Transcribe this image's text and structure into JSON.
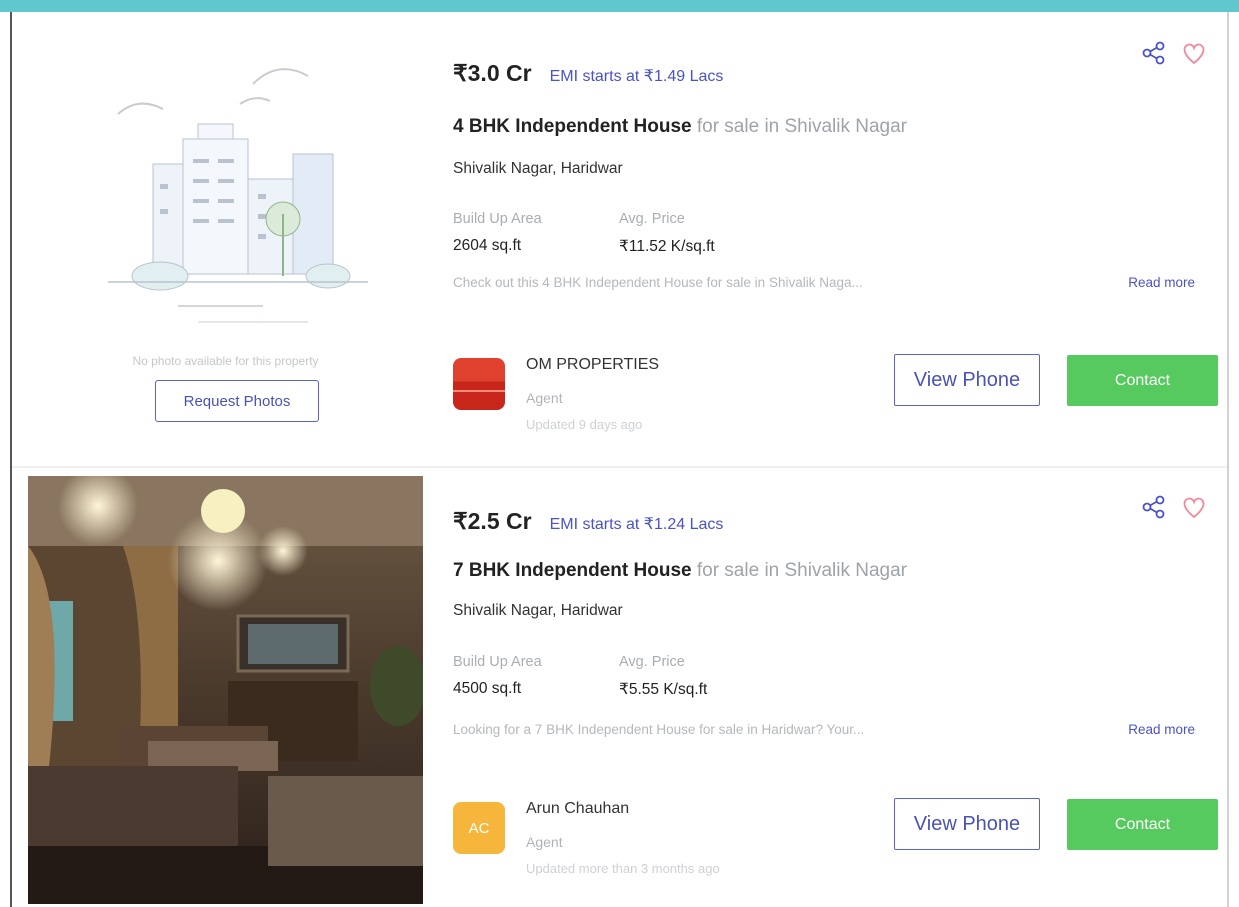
{
  "listings": [
    {
      "price": "₹3.0 Cr",
      "emi": "EMI starts at ₹1.49 Lacs",
      "title_bold": "4 BHK Independent House",
      "title_rest": " for sale in Shivalik Nagar",
      "locality": "Shivalik Nagar, Haridwar",
      "area_label": "Build Up Area",
      "area_value": "2604 sq.ft",
      "avg_label": "Avg. Price",
      "avg_value": "₹11.52 K/sq.ft",
      "description": "Check out this 4 BHK Independent House for sale in Shivalik Naga...",
      "read_more": "Read more",
      "no_photo_text": "No photo available for this property",
      "request_photos": "Request Photos",
      "agent_name": "OM PROPERTIES",
      "agent_role": "Agent",
      "updated": "Updated 9 days ago",
      "view_phone": "View Phone",
      "contact": "Contact"
    },
    {
      "price": "₹2.5 Cr",
      "emi": "EMI starts at ₹1.24 Lacs",
      "title_bold": "7 BHK Independent House",
      "title_rest": " for sale in Shivalik Nagar",
      "locality": "Shivalik Nagar, Haridwar",
      "area_label": "Build Up Area",
      "area_value": "4500 sq.ft",
      "avg_label": "Avg. Price",
      "avg_value": "₹5.55 K/sq.ft",
      "description": "Looking for a 7 BHK Independent House for sale in Haridwar? Your...",
      "read_more": "Read more",
      "agent_initials": "AC",
      "agent_name": "Arun Chauhan",
      "agent_role": "Agent",
      "updated": "Updated more than 3 months ago",
      "view_phone": "View Phone",
      "contact": "Contact"
    }
  ],
  "icons": {
    "share": "share-icon",
    "favorite": "heart-icon"
  },
  "colors": {
    "accent": "#4a52c8",
    "contact_green": "#56c95f",
    "heart": "#f08a9a",
    "top_bar": "#5fc8cf",
    "ac_avatar": "#f5b63b"
  }
}
